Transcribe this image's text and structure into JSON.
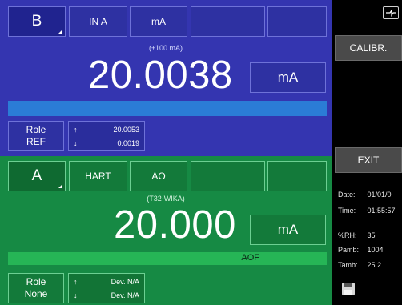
{
  "channel_b": {
    "channel_label": "B",
    "function_label": "IN A",
    "unit_label": "mA",
    "range_label": "(±100 mA)",
    "reading": "20.0038",
    "reading_unit": "mA",
    "role_title": "Role",
    "role_value": "REF",
    "stat_up_value": "20.0053",
    "stat_down_value": "0.0019",
    "arrow_up": "↑",
    "arrow_down": "↓"
  },
  "channel_a": {
    "channel_label": "A",
    "function_label": "HART",
    "mode_label": "AO",
    "device_label": "(T32-WIKA)",
    "reading": "20.000",
    "reading_unit": "mA",
    "status_label": "AOF",
    "role_title": "Role",
    "role_value": "None",
    "stat_up_value": "Dev. N/A",
    "stat_down_value": "Dev. N/A",
    "arrow_up": "↑",
    "arrow_down": "↓"
  },
  "side": {
    "calibr_label": "CALIBR.",
    "exit_label": "EXIT",
    "date_label": "Date:",
    "date_value": "01/01/0",
    "time_label": "Time:",
    "time_value": "01:55:57",
    "rh_label": "%RH:",
    "rh_value": "35",
    "pamb_label": "Pamb:",
    "pamb_value": "1004",
    "tamb_label": "Tamb:",
    "tamb_value": "25.2",
    "icons": [
      "power-plug-icon",
      "save-icon"
    ]
  }
}
